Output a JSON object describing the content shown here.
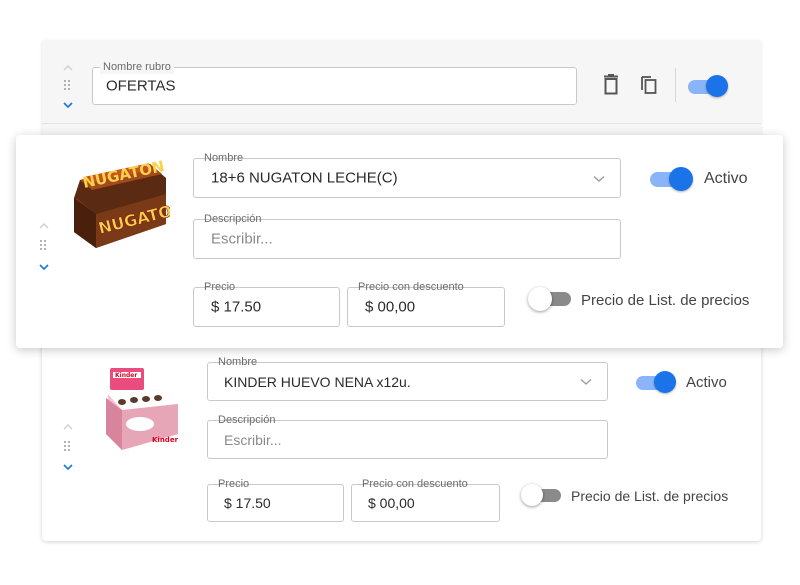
{
  "category": {
    "field_label": "Nombre rubro",
    "field_value": "OFERTAS",
    "toggle_on": true
  },
  "products": [
    {
      "name_label": "Nombre",
      "name_value": "18+6 NUGATON LECHE(C)",
      "description_label": "Descripción",
      "description_placeholder": "Escribir...",
      "price_label": "Precio",
      "price_value": "$ 17.50",
      "discount_label": "Precio con descuento",
      "discount_value": "$ 00,00",
      "active_label": "Activo",
      "active_on": true,
      "list_price_label": "Precio de List. de precios",
      "list_price_on": false,
      "image_text": "NUGATON"
    },
    {
      "name_label": "Nombre",
      "name_value": "KINDER HUEVO NENA x12u.",
      "description_label": "Descripción",
      "description_placeholder": "Escribir...",
      "price_label": "Precio",
      "price_value": "$ 17.50",
      "discount_label": "Precio con descuento",
      "discount_value": "$ 00,00",
      "active_label": "Activo",
      "active_on": true,
      "list_price_label": "Precio de List. de precios",
      "list_price_on": false,
      "image_text": "Kinder"
    }
  ],
  "colors": {
    "accent": "#1a73e8",
    "accent_track": "#8ab4f8",
    "off_knob": "#ffffff",
    "off_track": "#8a8a8a"
  }
}
